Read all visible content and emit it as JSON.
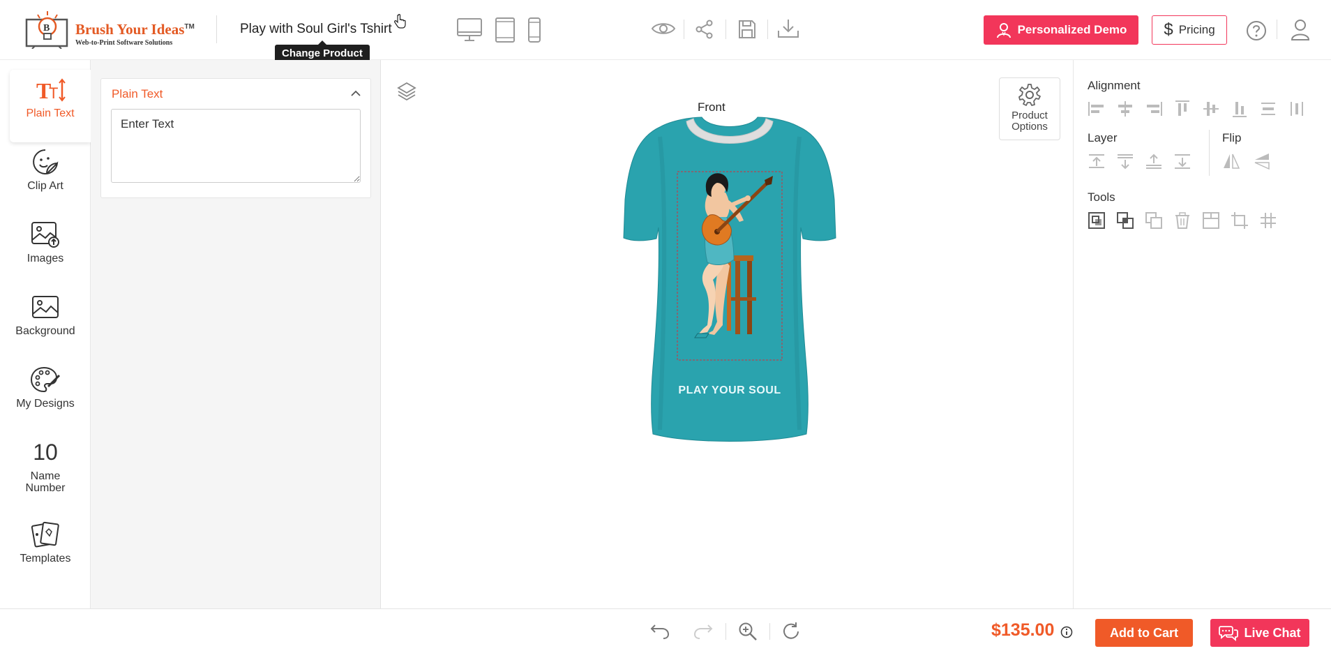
{
  "header": {
    "logo_name": "Brush Your Ideas",
    "logo_tm": "TM",
    "logo_tagline": "Web-to-Print Software Solutions",
    "product_title": "Play with Soul Girl's Tshirt",
    "tooltip": "Change Product",
    "device_icons": [
      "desktop-icon",
      "tablet-icon",
      "mobile-icon"
    ],
    "action_icons": [
      "preview-eye-icon",
      "share-icon",
      "save-icon",
      "download-icon"
    ],
    "demo_button": "Personalized Demo",
    "pricing_button": "Pricing",
    "pricing_symbol": "$"
  },
  "sidebar": {
    "items": [
      {
        "label": "Plain Text",
        "icon": "text-size-icon",
        "active": true
      },
      {
        "label": "Clip Art",
        "icon": "sticker-icon"
      },
      {
        "label": "Images",
        "icon": "image-upload-icon"
      },
      {
        "label": "Background",
        "icon": "image-icon"
      },
      {
        "label": "My Designs",
        "icon": "palette-icon"
      },
      {
        "label": "Name Number",
        "icon": "number-icon",
        "glyph": "10"
      },
      {
        "label": "Templates",
        "icon": "templates-icon"
      }
    ]
  },
  "text_panel": {
    "title": "Plain Text",
    "textarea_value": "Enter Text"
  },
  "canvas": {
    "side_label": "Front",
    "product_options": "Product Options",
    "print_text": "PLAY YOUR SOUL",
    "shirt_color": "#2aa3ae"
  },
  "right_panel": {
    "alignment_label": "Alignment",
    "layer_label": "Layer",
    "flip_label": "Flip",
    "tools_label": "Tools"
  },
  "footer": {
    "price": "$135.00",
    "add_to_cart": "Add to Cart",
    "live_chat": "Live Chat"
  },
  "colors": {
    "accent_orange": "#f05a28",
    "accent_pink": "#f2365a"
  }
}
